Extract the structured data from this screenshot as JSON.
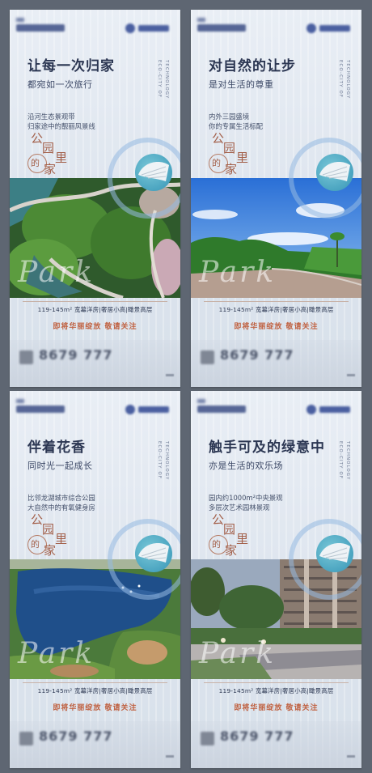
{
  "posters": [
    {
      "title": "让每一次归家",
      "subtitle": "都宛如一次旅行",
      "desc1": "沿河生态景观带",
      "desc2": "归家途中的靓丽风景线",
      "info": "119-145m² 宽幕洋房|奢居小高|瞰景高层",
      "soon": "即将华丽绽放  敬请关注",
      "phone": "8679 777",
      "watermark": "Park",
      "seal_chars": [
        "公",
        "园",
        "里",
        "的",
        "家"
      ],
      "vertical_en": [
        "ECO-CITY OF",
        "TECHNOLOGY"
      ],
      "photo": "aerial-park-path"
    },
    {
      "title": "对自然的让步",
      "subtitle": "是对生活的尊重",
      "desc1": "内外三园盛境",
      "desc2": "你的专属生活标配",
      "info": "119-145m² 宽幕洋房|奢居小高|瞰景高层",
      "soon": "即将华丽绽放  敬请关注",
      "phone": "8679 777",
      "watermark": "Park",
      "seal_chars": [
        "公",
        "园",
        "里",
        "的",
        "家"
      ],
      "vertical_en": [
        "ECO-CITY OF",
        "TECHNOLOGY"
      ],
      "photo": "road-blue-sky"
    },
    {
      "title": "伴着花香",
      "subtitle": "同时光一起成长",
      "desc1": "比邻龙湖城市综合公园",
      "desc2": "大自然中的有氧健身房",
      "info": "119-145m² 宽幕洋房|奢居小高|瞰景高层",
      "soon": "即将华丽绽放  敬请关注",
      "phone": "8679 777",
      "watermark": "Park",
      "seal_chars": [
        "公",
        "园",
        "里",
        "的",
        "家"
      ],
      "vertical_en": [
        "ECO-CITY OF",
        "TECHNOLOGY"
      ],
      "photo": "aerial-lake"
    },
    {
      "title": "触手可及的绿意中",
      "subtitle": "亦是生活的欢乐场",
      "desc1": "园内约1000m²中央景观",
      "desc2": "多层次艺术园林景观",
      "info": "119-145m² 宽幕洋房|奢居小高|瞰景高层",
      "soon": "即将华丽绽放  敬请关注",
      "phone": "8679 777",
      "watermark": "Park",
      "seal_chars": [
        "公",
        "园",
        "里",
        "的",
        "家"
      ],
      "vertical_en": [
        "ECO-CITY OF",
        "TECHNOLOGY"
      ],
      "photo": "residential-garden"
    }
  ],
  "colors": {
    "title": "#2b3652",
    "accent": "#c06242",
    "seal": "#a3604a",
    "background": "#5e6672"
  },
  "icons": [
    "logo-mark",
    "shell-emblem-icon",
    "qr-code-icon"
  ]
}
